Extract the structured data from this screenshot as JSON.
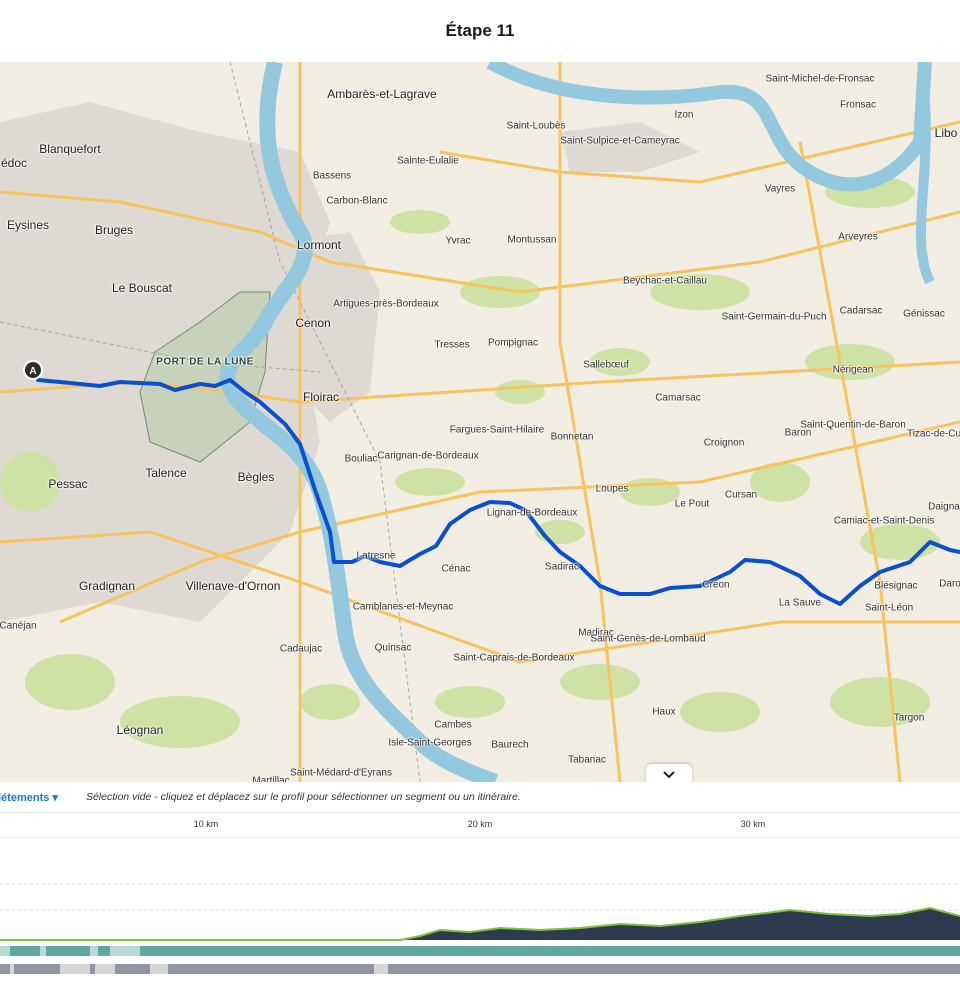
{
  "header": {
    "title": "Étape 11"
  },
  "map": {
    "start_marker": "A",
    "zone_label": "PORT DE LA LUNE",
    "places": [
      "Ambarès-et-Lagrave",
      "Saint-Michel-de-Fronsac",
      "Fronsac",
      "Libo",
      "Izon",
      "Saint-Loubès",
      "Saint-Sulpice-et-Cameyrac",
      "Blanquefort",
      "édoc",
      "Bassens",
      "Sainte-Eulalie",
      "Vayres",
      "Carbon-Blanc",
      "Arveyres",
      "Eysines",
      "Bruges",
      "Lormont",
      "Yvrac",
      "Montussan",
      "Beychac-et-Caillau",
      "Le Bouscat",
      "Artigues-près-Bordeaux",
      "Saint-Germain-du-Puch",
      "Cadarsac",
      "Génissac",
      "Cenon",
      "Tresses",
      "Pompignac",
      "Sallebœuf",
      "Nérigean",
      "Floirac",
      "Camarsac",
      "Saint-Quentin-de-Baron",
      "Fargues-Saint-Hilaire",
      "Bonnetan",
      "Croignon",
      "Baron",
      "Tizac-de-Cu",
      "Carignan-de-Bordeaux",
      "Bouliac",
      "Talence",
      "Pessac",
      "Bègles",
      "Loupes",
      "Le Pout",
      "Cursan",
      "Daigna",
      "Camiac-et-Saint-Denis",
      "Lignan-de-Bordeaux",
      "Latresne",
      "Cénac",
      "Sadirac",
      "Créon",
      "Daro",
      "Gradignan",
      "Villenave-d'Ornon",
      "Blésignac",
      "Camblanes-et-Meynac",
      "La Sauve",
      "Saint-Léon",
      "Canéjan",
      "Madirac",
      "Saint-Genès-de-Lombaud",
      "Cadaujac",
      "Quinsac",
      "Saint-Caprais-de-Bordeaux",
      "Haux",
      "Targon",
      "Léognan",
      "Cambes",
      "Isle-Saint-Georges",
      "Baurech",
      "Tabanac",
      "Saint-Médard-d'Eyrans",
      "Martillac"
    ]
  },
  "panel": {
    "dropdown_label": "létements",
    "hint": "Sélection vide - cliquez et déplacez sur le profil pour sélectionner un segment ou un itinéraire.",
    "axis_ticks": [
      {
        "label": "10 km",
        "km": 10
      },
      {
        "label": "20 km",
        "km": 20
      },
      {
        "label": "30 km",
        "km": 30
      }
    ]
  },
  "colors": {
    "route": "#0a4fd0",
    "river": "#93c8de",
    "road_major": "#f7c35e",
    "profile_fill": "#2e3a4d",
    "profile_line": "#7fc241",
    "surface_bar": "#5fa8a0",
    "waytype_bar": "#8f96a0"
  }
}
